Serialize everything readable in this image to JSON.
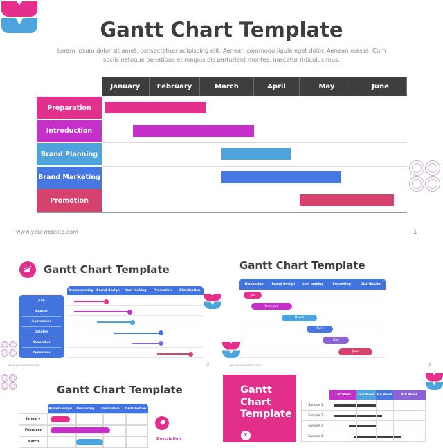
{
  "slide1": {
    "title": "Gantt Chart Template",
    "subtitle": "Lorem ipsum dolor sit amet, consectetuer adipiscing elit. Aenean commodo ligula eget dolor. Aenean massa. Cum sociis natoque penatibus et magnis dis parturient montes, nascetur ridiculus mus.",
    "months": [
      "January",
      "February",
      "March",
      "April",
      "May",
      "June"
    ],
    "tasks": [
      {
        "label": "Preparation",
        "color": "#e4308d",
        "start_month": 0.06,
        "end_month": 2.1
      },
      {
        "label": "Introduction",
        "color": "#c531c8",
        "start_month": 0.65,
        "end_month": 3.0
      },
      {
        "label": "Brand Planning",
        "color": "#4fa3dd",
        "start_month": 2.4,
        "end_month": 3.8
      },
      {
        "label": "Brand Marketing",
        "color": "#4677e2",
        "start_month": 2.4,
        "end_month": 4.75
      },
      {
        "label": "Promotion",
        "color": "#d6426d",
        "start_month": 4.0,
        "end_month": 5.75
      }
    ],
    "footer_url": "www.yourwebsite.com",
    "page_number": "1"
  },
  "slide2": {
    "title": "Gantt Chart Template",
    "phases": [
      "Brainstroming",
      "Brand design",
      "Item making",
      "Promotion",
      "Distribution"
    ],
    "rows": [
      {
        "month": "July",
        "color": "#e4308d",
        "start": 0.05,
        "end": 0.29
      },
      {
        "month": "August",
        "color": "#c531c8",
        "start": 0.05,
        "end": 0.46
      },
      {
        "month": "September",
        "color": "#4fa3dd",
        "start": 0.22,
        "end": 0.48
      },
      {
        "month": "October",
        "color": "#4677e2",
        "start": 0.34,
        "end": 0.69
      },
      {
        "month": "November",
        "color": "#8b62d8",
        "start": 0.47,
        "end": 0.69
      },
      {
        "month": "December",
        "color": "#d6426d",
        "start": 0.66,
        "end": 0.91
      }
    ],
    "footer_url": "www.yourwebsite.com",
    "page_number": "2"
  },
  "slide3": {
    "title": "Gantt Chart Template",
    "phases": [
      "Discussion",
      "Brand design",
      "Item making",
      "Promotion",
      "Distribution"
    ],
    "rows": [
      {
        "label": "Jan",
        "color": "#e4308d",
        "start": 0.03,
        "end": 0.15
      },
      {
        "label": "February",
        "color": "#c531c8",
        "start": 0.08,
        "end": 0.36
      },
      {
        "label": "March",
        "color": "#4fa3dd",
        "start": 0.29,
        "end": 0.53
      },
      {
        "label": "April",
        "color": "#4677e2",
        "start": 0.46,
        "end": 0.64
      },
      {
        "label": "May",
        "color": "#8b62d8",
        "start": 0.57,
        "end": 0.75
      },
      {
        "label": "June",
        "color": "#d6426d",
        "start": 0.68,
        "end": 0.91
      }
    ],
    "footer_url": "www.yourwebsite.com",
    "page_number": "3"
  },
  "slide4": {
    "title": "Gantt Chart Template",
    "phases": [
      "Brand design",
      "Producing",
      "Promotion",
      "Distribution"
    ],
    "rows": [
      {
        "month": "January",
        "color": "#e4308d",
        "start": 0.03,
        "end": 0.22
      },
      {
        "month": "February",
        "color": "#c531c8",
        "start": 0.03,
        "end": 0.62
      },
      {
        "month": "March",
        "color": "#4fa3dd",
        "start": 0.28,
        "end": 0.55
      }
    ],
    "description_label": "Description"
  },
  "slide5": {
    "title_lines": [
      "Gantt",
      "Chart",
      "Template"
    ],
    "weeks": [
      {
        "label": "1st Week",
        "color": "#c531c8"
      },
      {
        "label": "2nd Week",
        "color": "#4fa3dd"
      },
      {
        "label": "3rd Week",
        "color": "#4677e2"
      },
      {
        "label": "4th Week",
        "color": "#8b62d8"
      }
    ],
    "rows": [
      {
        "label": "Sample 1",
        "start": 0.05,
        "end": 0.48
      },
      {
        "label": "Sample 2",
        "start": 0.05,
        "end": 0.55
      },
      {
        "label": "Sample 3",
        "start": 0.2,
        "end": 0.5
      },
      {
        "label": "Sample 4",
        "start": 0.25,
        "end": 0.75
      }
    ]
  }
}
